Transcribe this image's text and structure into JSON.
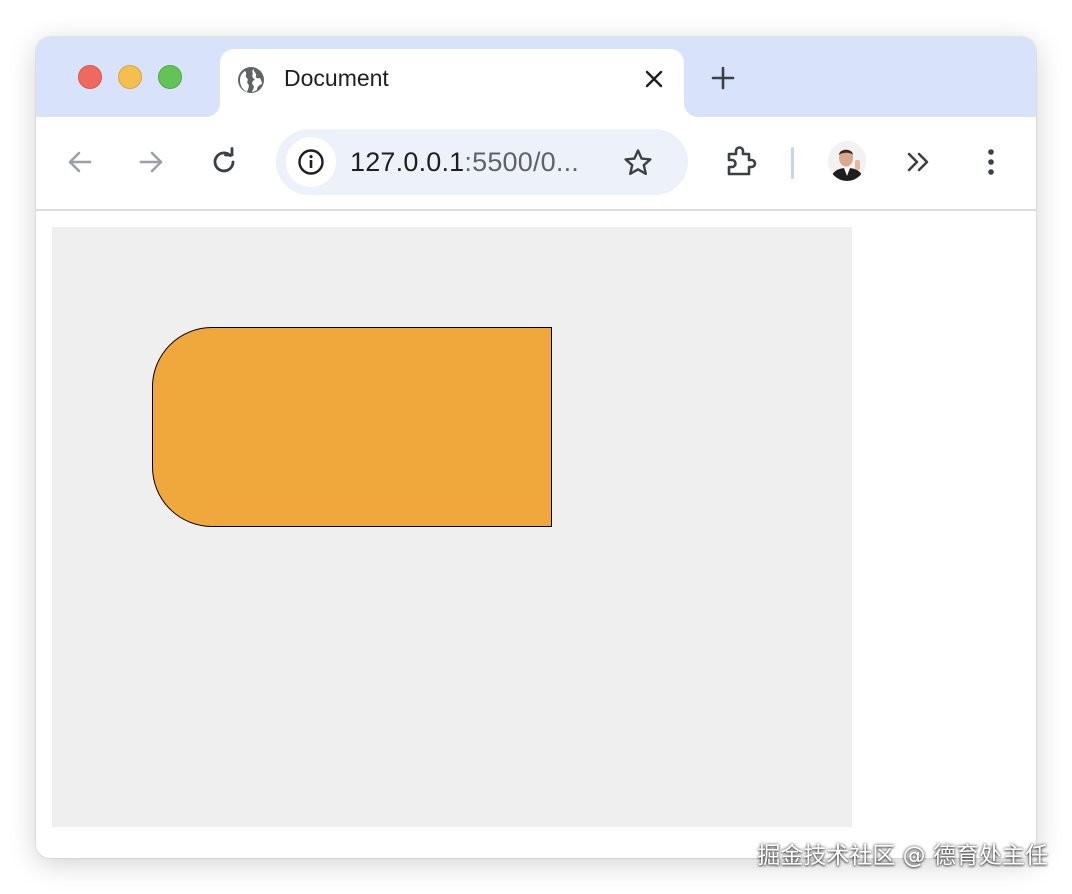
{
  "tab": {
    "title": "Document",
    "favicon": "globe-icon"
  },
  "address_bar": {
    "host": "127.0.0.1",
    "rest": ":5500/0..."
  },
  "toolbar_icons": [
    "back-arrow-icon",
    "forward-arrow-icon",
    "reload-icon",
    "info-icon",
    "star-icon",
    "extensions-puzzle-icon",
    "profile-avatar",
    "chevron-double-right-icon",
    "kebab-menu-icon"
  ],
  "colors": {
    "tabstrip": "#d8e3fb",
    "omnibox": "#edf2fa",
    "canvas_background": "#efefef",
    "shape_fill": "#f0a73c",
    "shape_stroke": "#000000"
  },
  "watermark": "掘金技术社区 @ 德育处主任"
}
